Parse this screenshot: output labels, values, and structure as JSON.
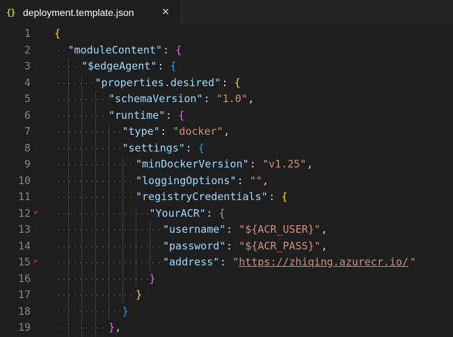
{
  "tab": {
    "icon": "{}",
    "title": "deployment.template.json",
    "close_glyph": "×"
  },
  "editor": {
    "language": "json",
    "lines": [
      {
        "n": "1",
        "indent": 0,
        "tokens": [
          {
            "t": "{",
            "c": "b1"
          }
        ]
      },
      {
        "n": "2",
        "indent": 1,
        "tokens": [
          {
            "t": "\"moduleContent\"",
            "c": "key"
          },
          {
            "t": ": ",
            "c": "punc"
          },
          {
            "t": "{",
            "c": "b2"
          }
        ]
      },
      {
        "n": "3",
        "indent": 2,
        "tokens": [
          {
            "t": "\"$edgeAgent\"",
            "c": "key"
          },
          {
            "t": ": ",
            "c": "punc"
          },
          {
            "t": "{",
            "c": "b3"
          }
        ]
      },
      {
        "n": "4",
        "indent": 3,
        "tokens": [
          {
            "t": "\"properties.desired\"",
            "c": "key"
          },
          {
            "t": ": ",
            "c": "punc"
          },
          {
            "t": "{",
            "c": "b1"
          }
        ]
      },
      {
        "n": "5",
        "indent": 4,
        "tokens": [
          {
            "t": "\"schemaVersion\"",
            "c": "key"
          },
          {
            "t": ": ",
            "c": "punc"
          },
          {
            "t": "\"1.0\"",
            "c": "str"
          },
          {
            "t": ",",
            "c": "punc"
          }
        ]
      },
      {
        "n": "6",
        "indent": 4,
        "tokens": [
          {
            "t": "\"runtime\"",
            "c": "key"
          },
          {
            "t": ": ",
            "c": "punc"
          },
          {
            "t": "{",
            "c": "b2"
          }
        ]
      },
      {
        "n": "7",
        "indent": 5,
        "tokens": [
          {
            "t": "\"type\"",
            "c": "key"
          },
          {
            "t": ": ",
            "c": "punc"
          },
          {
            "t": "\"docker\"",
            "c": "str"
          },
          {
            "t": ",",
            "c": "punc"
          }
        ]
      },
      {
        "n": "8",
        "indent": 5,
        "tokens": [
          {
            "t": "\"settings\"",
            "c": "key"
          },
          {
            "t": ": ",
            "c": "punc"
          },
          {
            "t": "{",
            "c": "b3"
          }
        ]
      },
      {
        "n": "9",
        "indent": 6,
        "tokens": [
          {
            "t": "\"minDockerVersion\"",
            "c": "key"
          },
          {
            "t": ": ",
            "c": "punc"
          },
          {
            "t": "\"v1.25\"",
            "c": "str"
          },
          {
            "t": ",",
            "c": "punc"
          }
        ]
      },
      {
        "n": "10",
        "indent": 6,
        "tokens": [
          {
            "t": "\"loggingOptions\"",
            "c": "key"
          },
          {
            "t": ": ",
            "c": "punc"
          },
          {
            "t": "\"\"",
            "c": "str"
          },
          {
            "t": ",",
            "c": "punc"
          }
        ]
      },
      {
        "n": "11",
        "indent": 6,
        "tokens": [
          {
            "t": "\"registryCredentials\"",
            "c": "key"
          },
          {
            "t": ": ",
            "c": "punc"
          },
          {
            "t": "{",
            "c": "b1"
          }
        ]
      },
      {
        "n": "12",
        "indent": 7,
        "marker": true,
        "tokens": [
          {
            "t": "\"YourACR\"",
            "c": "key"
          },
          {
            "t": ": ",
            "c": "punc"
          },
          {
            "t": "{",
            "c": "b2"
          }
        ]
      },
      {
        "n": "13",
        "indent": 8,
        "tokens": [
          {
            "t": "\"username\"",
            "c": "key"
          },
          {
            "t": ": ",
            "c": "punc"
          },
          {
            "t": "\"${ACR_USER}\"",
            "c": "str"
          },
          {
            "t": ",",
            "c": "punc"
          }
        ]
      },
      {
        "n": "14",
        "indent": 8,
        "tokens": [
          {
            "t": "\"password\"",
            "c": "key"
          },
          {
            "t": ": ",
            "c": "punc"
          },
          {
            "t": "\"${ACR_PASS}\"",
            "c": "str"
          },
          {
            "t": ",",
            "c": "punc"
          }
        ]
      },
      {
        "n": "15",
        "indent": 8,
        "marker": true,
        "tokens": [
          {
            "t": "\"address\"",
            "c": "key"
          },
          {
            "t": ": ",
            "c": "punc"
          },
          {
            "t": "\"",
            "c": "str"
          },
          {
            "t": "https://zhiqing.azurecr.io/",
            "c": "url"
          },
          {
            "t": "\"",
            "c": "str"
          }
        ]
      },
      {
        "n": "16",
        "indent": 7,
        "tokens": [
          {
            "t": "}",
            "c": "b2"
          }
        ]
      },
      {
        "n": "17",
        "indent": 6,
        "tokens": [
          {
            "t": "}",
            "c": "b1"
          }
        ]
      },
      {
        "n": "18",
        "indent": 5,
        "tokens": [
          {
            "t": "}",
            "c": "b3"
          }
        ]
      },
      {
        "n": "19",
        "indent": 4,
        "tokens": [
          {
            "t": "}",
            "c": "b2"
          },
          {
            "t": ",",
            "c": "punc"
          }
        ]
      }
    ]
  }
}
